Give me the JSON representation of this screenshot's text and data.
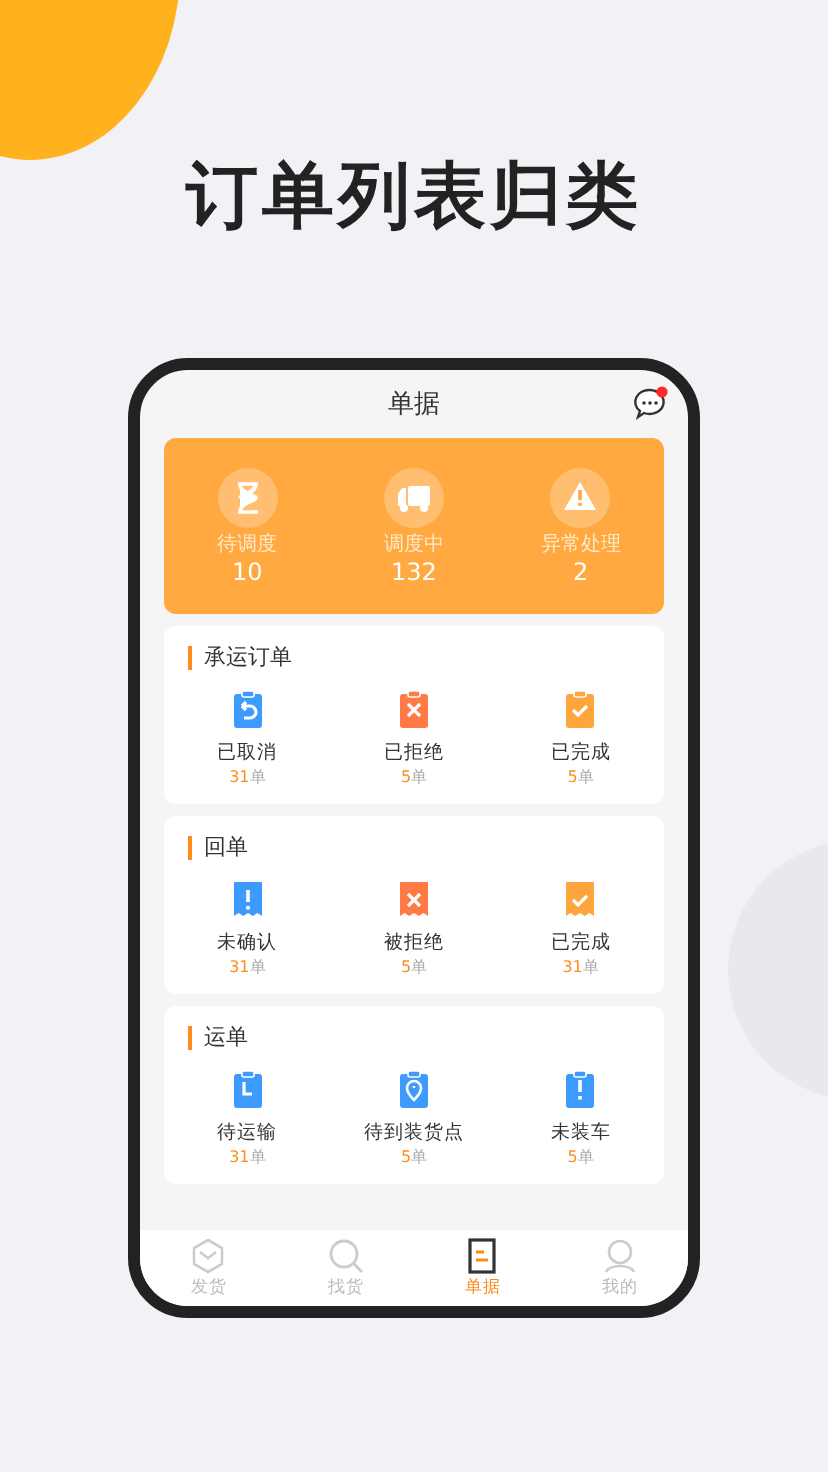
{
  "headline": "订单列表归类",
  "phone": {
    "title": "单据",
    "has_unread": true,
    "summary": [
      {
        "kind": "hourglass",
        "label": "待调度",
        "value": "10"
      },
      {
        "kind": "truck",
        "label": "调度中",
        "value": "132"
      },
      {
        "kind": "warning",
        "label": "异常处理",
        "value": "2"
      }
    ],
    "sections": [
      {
        "title": "承运订单",
        "kind": "clipboard",
        "items": [
          {
            "label": "已取消",
            "count": "31",
            "unit": "单",
            "kind": "undo",
            "color": "#3d9bff"
          },
          {
            "label": "已拒绝",
            "count": "5",
            "unit": "单",
            "kind": "cross",
            "color": "#ff7a45"
          },
          {
            "label": "已完成",
            "count": "5",
            "unit": "单",
            "kind": "check",
            "color": "#ffa53d"
          }
        ]
      },
      {
        "title": "回单",
        "kind": "receipt",
        "items": [
          {
            "label": "未确认",
            "count": "31",
            "unit": "单",
            "kind": "alert",
            "color": "#3d9bff"
          },
          {
            "label": "被拒绝",
            "count": "5",
            "unit": "单",
            "kind": "cross",
            "color": "#ff7a45"
          },
          {
            "label": "已完成",
            "count": "31",
            "unit": "单",
            "kind": "check",
            "color": "#ffa53d"
          }
        ]
      },
      {
        "title": "运单",
        "kind": "clipboard",
        "items": [
          {
            "label": "待运输",
            "count": "31",
            "unit": "单",
            "kind": "clock",
            "color": "#3d9bff"
          },
          {
            "label": "待到装货点",
            "count": "5",
            "unit": "单",
            "kind": "pin",
            "color": "#3d9bff"
          },
          {
            "label": "未装车",
            "count": "5",
            "unit": "单",
            "kind": "alert",
            "color": "#3d9bff"
          }
        ]
      }
    ],
    "nav": [
      {
        "kind": "box",
        "label": "发货",
        "selected": false
      },
      {
        "kind": "search",
        "label": "找货",
        "selected": false
      },
      {
        "kind": "doc",
        "label": "单据",
        "selected": true
      },
      {
        "kind": "person",
        "label": "我的",
        "selected": false
      }
    ]
  }
}
